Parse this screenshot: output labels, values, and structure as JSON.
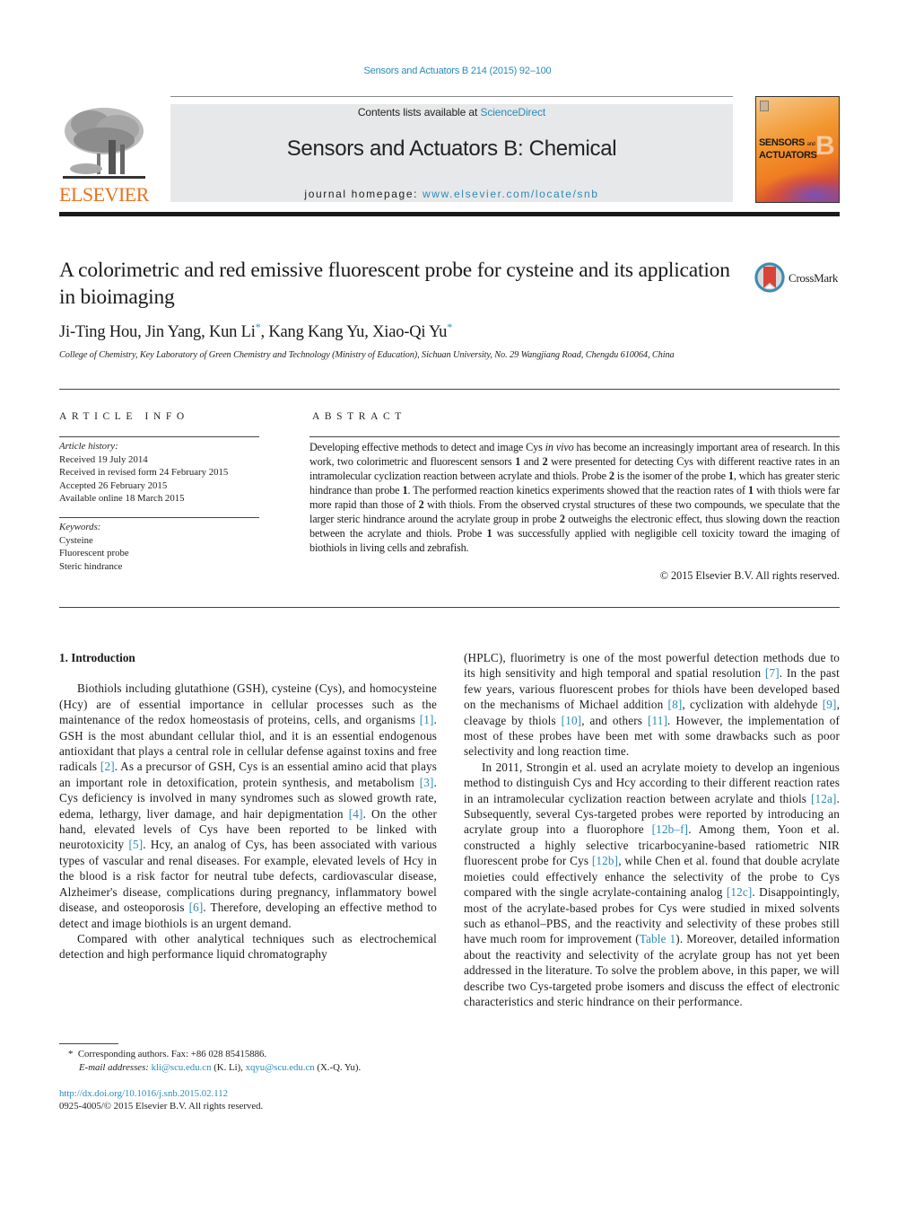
{
  "header": {
    "journal_citation": "Sensors and Actuators B 214 (2015) 92–100",
    "contents_prefix": "Contents lists available at ",
    "contents_link": "ScienceDirect",
    "journal_name": "Sensors and Actuators B: Chemical",
    "homepage_prefix": "journal homepage: ",
    "homepage_link": "www.elsevier.com/locate/snb",
    "publisher_logo": "ELSEVIER",
    "cover_title_line1": "SENSORS",
    "cover_title_and": "and",
    "cover_title_line2": "ACTUATORS",
    "cover_letter": "B",
    "colors": {
      "link": "#2a8ab8",
      "elsevier_orange": "#e9711c",
      "banner_gray": "#e7e8e9"
    }
  },
  "article": {
    "title": "A colorimetric and red emissive fluorescent probe for cysteine and its application in bioimaging",
    "crossmark_label": "CrossMark",
    "authors": [
      {
        "name": "Ji-Ting Hou",
        "corresponding": false
      },
      {
        "name": "Jin Yang",
        "corresponding": false
      },
      {
        "name": "Kun Li",
        "corresponding": true
      },
      {
        "name": "Kang Kang Yu",
        "corresponding": false
      },
      {
        "name": "Xiao-Qi Yu",
        "corresponding": true
      }
    ],
    "author_separator": ", ",
    "star": "*",
    "affiliation": "College of Chemistry, Key Laboratory of Green Chemistry and Technology (Ministry of Education), Sichuan University, No. 29 Wangjiang Road, Chengdu 610064, China"
  },
  "article_info": {
    "heading": "ARTICLE INFO",
    "history_label": "Article history:",
    "history": [
      "Received 19 July 2014",
      "Received in revised form 24 February 2015",
      "Accepted 26 February 2015",
      "Available online 18 March 2015"
    ],
    "keywords_label": "Keywords:",
    "keywords": [
      "Cysteine",
      "Fluorescent probe",
      "Steric hindrance"
    ]
  },
  "abstract": {
    "heading": "ABSTRACT",
    "segments": [
      {
        "t": "Developing effective methods to detect and image Cys "
      },
      {
        "t": "in vivo",
        "i": true
      },
      {
        "t": " has become an increasingly important area of research. In this work, two colorimetric and fluorescent sensors "
      },
      {
        "t": "1",
        "b": true
      },
      {
        "t": " and "
      },
      {
        "t": "2",
        "b": true
      },
      {
        "t": " were presented for detecting Cys with different reactive rates in an intramolecular cyclization reaction between acrylate and thiols. Probe "
      },
      {
        "t": "2",
        "b": true
      },
      {
        "t": " is the isomer of the probe "
      },
      {
        "t": "1",
        "b": true
      },
      {
        "t": ", which has greater steric hindrance than probe "
      },
      {
        "t": "1",
        "b": true
      },
      {
        "t": ". The performed reaction kinetics experiments showed that the reaction rates of "
      },
      {
        "t": "1",
        "b": true
      },
      {
        "t": " with thiols were far more rapid than those of "
      },
      {
        "t": "2",
        "b": true
      },
      {
        "t": " with thiols. From the observed crystal structures of these two compounds, we speculate that the larger steric hindrance around the acrylate group in probe "
      },
      {
        "t": "2",
        "b": true
      },
      {
        "t": " outweighs the electronic effect, thus slowing down the reaction between the acrylate and thiols. Probe "
      },
      {
        "t": "1",
        "b": true
      },
      {
        "t": " was successfully applied with negligible cell toxicity toward the imaging of biothiols in living cells and zebrafish."
      }
    ],
    "copyright": "© 2015 Elsevier B.V. All rights reserved."
  },
  "body": {
    "section_heading": "1.  Introduction",
    "paragraphs": [
      {
        "col": "left",
        "indent": true,
        "segments": [
          {
            "t": "Biothiols including glutathione (GSH), cysteine (Cys), and homocysteine (Hcy) are of essential importance in cellular processes such as the maintenance of the redox homeostasis of proteins, cells, and organisms "
          },
          {
            "t": "[1]",
            "ref": true
          },
          {
            "t": ". GSH is the most abundant cellular thiol, and it is an essential endogenous antioxidant that plays a central role in cellular defense against toxins and free radicals "
          },
          {
            "t": "[2]",
            "ref": true
          },
          {
            "t": ". As a precursor of GSH, Cys is an essential amino acid that plays an important role in detoxification, protein synthesis, and metabolism "
          },
          {
            "t": "[3]",
            "ref": true
          },
          {
            "t": ". Cys deficiency is involved in many syndromes such as slowed growth rate, edema, lethargy, liver damage, and hair depigmentation "
          },
          {
            "t": "[4]",
            "ref": true
          },
          {
            "t": ". On the other hand, elevated levels of Cys have been reported to be linked with neurotoxicity "
          },
          {
            "t": "[5]",
            "ref": true
          },
          {
            "t": ". Hcy, an analog of Cys, has been associated with various types of vascular and renal diseases. For example, elevated levels of Hcy in the blood is a risk factor for neutral tube defects, cardiovascular disease, Alzheimer's disease, complications during pregnancy, inflammatory bowel disease, and osteoporosis "
          },
          {
            "t": "[6]",
            "ref": true
          },
          {
            "t": ". Therefore, developing an effective method to detect and image biothiols is an urgent demand."
          }
        ]
      },
      {
        "col": "left",
        "indent": true,
        "segments": [
          {
            "t": "Compared with other analytical techniques such as electrochemical detection and high performance liquid chromatography"
          }
        ]
      },
      {
        "col": "right",
        "indent": false,
        "segments": [
          {
            "t": "(HPLC), fluorimetry is one of the most powerful detection methods due to its high sensitivity and high temporal and spatial resolution "
          },
          {
            "t": "[7]",
            "ref": true
          },
          {
            "t": ". In the past few years, various fluorescent probes for thiols have been developed based on the mechanisms of Michael addition "
          },
          {
            "t": "[8]",
            "ref": true
          },
          {
            "t": ", cyclization with aldehyde "
          },
          {
            "t": "[9]",
            "ref": true
          },
          {
            "t": ", cleavage by thiols "
          },
          {
            "t": "[10]",
            "ref": true
          },
          {
            "t": ", and others "
          },
          {
            "t": "[11]",
            "ref": true
          },
          {
            "t": ". However, the implementation of most of these probes have been met with some drawbacks such as poor selectivity and long reaction time."
          }
        ]
      },
      {
        "col": "right",
        "indent": true,
        "segments": [
          {
            "t": "In 2011, Strongin et al. used an acrylate moiety to develop an ingenious method to distinguish Cys and Hcy according to their different reaction rates in an intramolecular cyclization reaction between acrylate and thiols "
          },
          {
            "t": "[12a]",
            "ref": true
          },
          {
            "t": ". Subsequently, several Cys-targeted probes were reported by introducing an acrylate group into a fluorophore "
          },
          {
            "t": "[12b–f]",
            "ref": true
          },
          {
            "t": ". Among them, Yoon et al. constructed a highly selective tricarbocyanine-based ratiometric NIR fluorescent probe for Cys "
          },
          {
            "t": "[12b]",
            "ref": true
          },
          {
            "t": ", while Chen et al. found that double acrylate moieties could effectively enhance the selectivity of the probe to Cys compared with the single acrylate-containing analog "
          },
          {
            "t": "[12c]",
            "ref": true
          },
          {
            "t": ". Disappointingly, most of the acrylate-based probes for Cys were studied in mixed solvents such as ethanol–PBS, and the reactivity and selectivity of these probes still have much room for improvement ("
          },
          {
            "t": "Table 1",
            "ref": true
          },
          {
            "t": "). Moreover, detailed information about the reactivity and selectivity of the acrylate group has not yet been addressed in the literature. To solve the problem above, in this paper, we will describe two Cys-targeted probe isomers and discuss the effect of electronic characteristics and steric hindrance on their performance."
          }
        ]
      }
    ]
  },
  "footnotes": {
    "star": "*",
    "corresponding": "Corresponding authors. Fax: +86 028 85415886.",
    "email_label": "E-mail addresses:",
    "email_1": "kli@scu.edu.cn",
    "email_1_owner": " (K. Li), ",
    "email_2": "xqyu@scu.edu.cn",
    "email_2_owner": " (X.-Q. Yu).",
    "doi": "http://dx.doi.org/10.1016/j.snb.2015.02.112",
    "issn": "0925-4005/© 2015 Elsevier B.V. All rights reserved."
  }
}
